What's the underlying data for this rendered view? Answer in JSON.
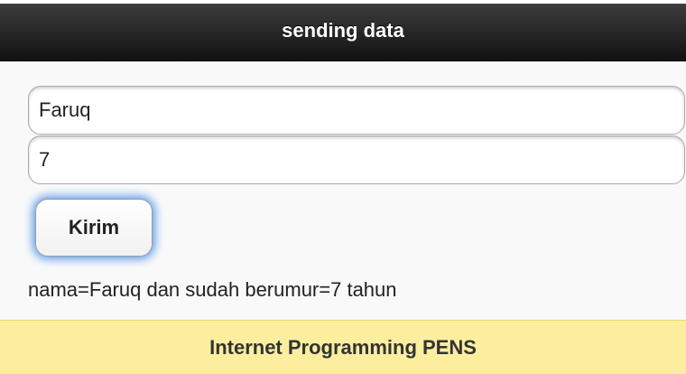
{
  "header": {
    "title": "sending data"
  },
  "form": {
    "name_value": "Faruq",
    "age_value": "7",
    "submit_label": "Kirim"
  },
  "result": {
    "text": "nama=Faruq dan sudah berumur=7 tahun"
  },
  "footer": {
    "title": "Internet Programming PENS"
  },
  "colors": {
    "header_bg": "#1a1a1a",
    "footer_bg": "#fbef9f",
    "focus_glow": "#5d9cec"
  }
}
